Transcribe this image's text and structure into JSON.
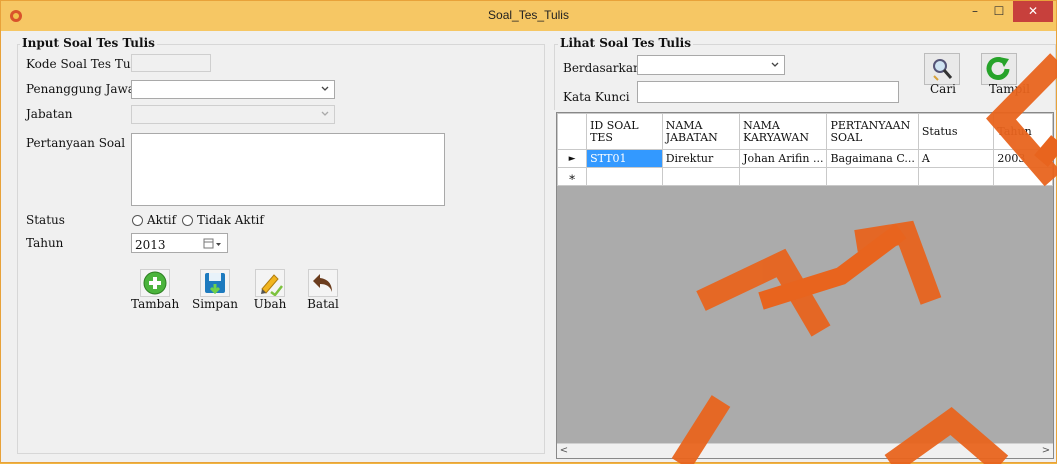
{
  "window": {
    "title": "Soal_Tes_Tulis",
    "min": "–",
    "max": "☐",
    "close": "✕"
  },
  "input_group": {
    "title": "Input Soal Tes Tulis",
    "kode_label": "Kode Soal Tes Tulis",
    "kode_value": "",
    "penanggung_label": "Penanggung Jawab",
    "penanggung_value": "",
    "jabatan_label": "Jabatan",
    "jabatan_value": "",
    "pertanyaan_label": "Pertanyaan Soal",
    "pertanyaan_value": "",
    "status_label": "Status",
    "status_aktif": "Aktif",
    "status_tidak": "Tidak Aktif",
    "tahun_label": "Tahun",
    "tahun_value": "2013",
    "buttons": {
      "tambah": "Tambah",
      "simpan": "Simpan",
      "ubah": "Ubah",
      "batal": "Batal"
    }
  },
  "lihat_group": {
    "title": "Lihat Soal Tes Tulis",
    "berdasarkan_label": "Berdasarkan",
    "berdasarkan_value": "",
    "kata_kunci_label": "Kata Kunci",
    "kata_kunci_value": "",
    "cari_label": "Cari",
    "tampil_label": "Tampil"
  },
  "grid": {
    "columns": [
      "ID SOAL TES",
      "NAMA JABATAN",
      "NAMA KARYAWAN",
      "PERTANYAAN SOAL",
      "Status",
      "Tahun"
    ],
    "rows": [
      {
        "marker": "►",
        "cells": [
          "STT01",
          "Direktur",
          "Johan Arifin ...",
          "Bagaimana C...",
          "A",
          "2003"
        ]
      },
      {
        "marker": "∗",
        "cells": [
          "",
          "",
          "",
          "",
          "",
          ""
        ]
      }
    ],
    "scroll_left": "<",
    "scroll_right": ">"
  },
  "colors": {
    "titlebar": "#f6c764",
    "close": "#c7403c",
    "selection": "#3399ff",
    "watermark": "#e8641e"
  }
}
